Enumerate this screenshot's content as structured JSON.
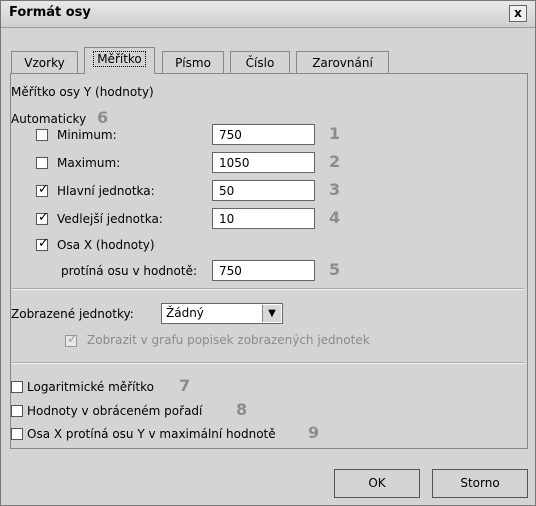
{
  "window": {
    "title": "Formát osy",
    "close_label": "x"
  },
  "tabs": [
    {
      "label": "Vzorky"
    },
    {
      "label": "Měřítko"
    },
    {
      "label": "Písmo"
    },
    {
      "label": "Číslo"
    },
    {
      "label": "Zarovnání"
    }
  ],
  "section_title": "Měřítko osy Y (hodnoty)",
  "automatic_label": "Automaticky",
  "automatic_num": "6",
  "fields": [
    {
      "label": "Minimum:",
      "value": "750",
      "num": "1",
      "checked": false
    },
    {
      "label": "Maximum:",
      "value": "1050",
      "num": "2",
      "checked": false
    },
    {
      "label": "Hlavní jednotka:",
      "value": "50",
      "num": "3",
      "checked": true
    },
    {
      "label": "Vedlejší jednotka:",
      "value": "10",
      "num": "4",
      "checked": true
    }
  ],
  "xaxis": {
    "label": "Osa X (hodnoty)",
    "subtitle": "protíná osu v hodnotě:",
    "value": "750",
    "num": "5",
    "checked": true
  },
  "display_units": {
    "label": "Zobrazené jednotky:",
    "selected": "Žádný",
    "checkbox_label": "Zobrazit v grafu popisek zobrazených jednotek",
    "checked": true
  },
  "options": [
    {
      "label": "Logaritmické měřítko",
      "num": "7",
      "checked": false
    },
    {
      "label": "Hodnoty v obráceném pořadí",
      "num": "8",
      "checked": false
    },
    {
      "label": "Osa X protíná osu Y v maximální hodnotě",
      "num": "9",
      "checked": false
    }
  ],
  "buttons": {
    "ok": "OK",
    "cancel": "Storno"
  },
  "icons": {
    "close": "close-icon",
    "check": "check-icon",
    "dropdown": "chevron-down-icon"
  }
}
